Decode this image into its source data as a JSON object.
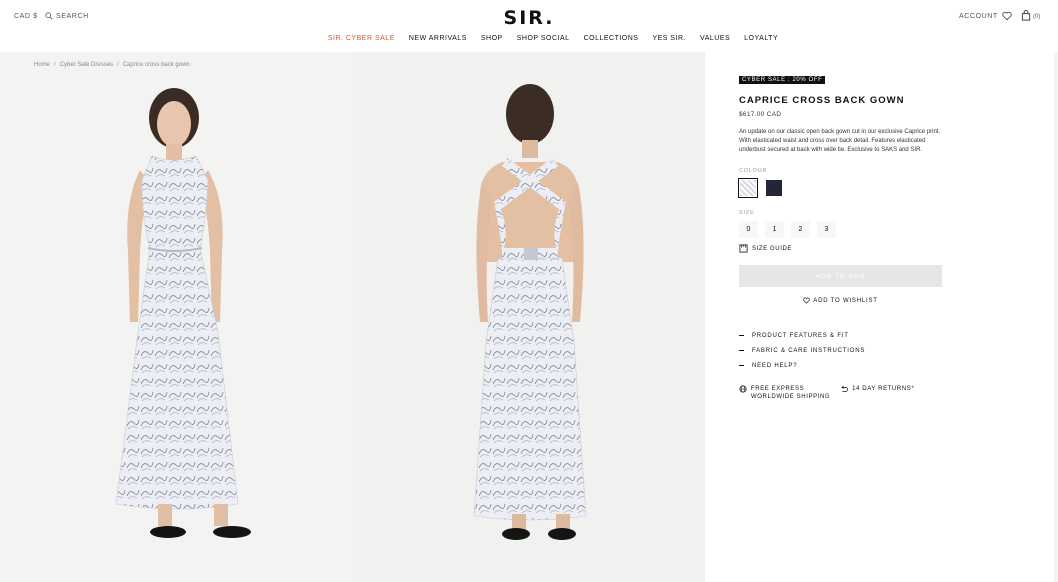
{
  "header": {
    "currency": "CAD $",
    "search_label": "SEARCH",
    "logo": "SIR.",
    "account_label": "ACCOUNT",
    "bag_count": "(0)"
  },
  "nav": {
    "items": [
      {
        "label": "SIR. CYBER SALE",
        "highlight": true
      },
      {
        "label": "NEW ARRIVALS"
      },
      {
        "label": "SHOP"
      },
      {
        "label": "SHOP SOCIAL"
      },
      {
        "label": "COLLECTIONS"
      },
      {
        "label": "YES SIR."
      },
      {
        "label": "VALUES"
      },
      {
        "label": "LOYALTY"
      }
    ],
    "sale_color": "#d9541e"
  },
  "breadcrumb": {
    "home": "Home",
    "category": "Cyber Sale Dresses",
    "current": "Caprice cross back gown",
    "separator": "/"
  },
  "product": {
    "promo_badge": "CYBER SALE : 20% OFF",
    "title": "CAPRICE CROSS BACK GOWN",
    "price": "$617.00 CAD",
    "description": "An update on our classic open back gown cut in our exclusive Caprice print. With elasticated waist and cross over back detail. Features elasticated underbust secured at back with wide tie. Exclusive to SAKS and SIR.",
    "colour_label": "COLOUR",
    "colours": [
      {
        "name": "caprice-print",
        "selected": true
      },
      {
        "name": "navy",
        "hex": "#23253a",
        "selected": false
      }
    ],
    "size_label": "SIZE",
    "sizes": [
      "0",
      "1",
      "2",
      "3"
    ],
    "size_guide": "SIZE GUIDE",
    "add_to_bag": "ADD TO BAG",
    "add_to_wishlist": "ADD TO WISHLIST",
    "accordions": [
      "PRODUCT FEATURES & FIT",
      "FABRIC & CARE INSTRUCTIONS",
      "NEED HELP?"
    ],
    "perks": {
      "shipping": "FREE EXPRESS WORLDWIDE SHIPPING",
      "shipping_line1": "FREE EXPRESS",
      "shipping_line2": "WORLDWIDE SHIPPING",
      "returns": "14 DAY RETURNS*"
    }
  },
  "icons": {
    "search": "search-icon",
    "wishlist": "heart-icon",
    "bag": "shopping-bag-icon",
    "size_guide": "ruler-icon",
    "shipping": "globe-icon",
    "returns": "return-arrow-icon"
  }
}
